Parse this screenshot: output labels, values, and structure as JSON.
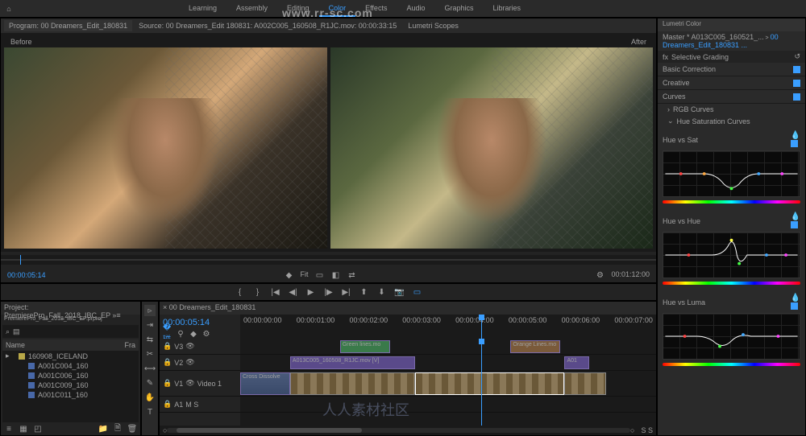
{
  "watermark": "www.rr-sc.com",
  "watermark2": "人人素材社区",
  "workspace_tabs": [
    "Learning",
    "Assembly",
    "Editing",
    "Color",
    "Effects",
    "Audio",
    "Graphics",
    "Libraries"
  ],
  "active_ws": "Color",
  "program": {
    "title": "Program: 00 Dreamers_Edit_180831",
    "source_tab": "Source: 00 Dreamers_Edit 180831: A002C005_160508_R1JC.mov: 00:00:33:15",
    "scopes_tab": "Lumetri Scopes",
    "before": "Before",
    "after": "After",
    "tc_in": "00:00:05:14",
    "tc_out": "00:01:12:00",
    "fit": "Fit"
  },
  "project": {
    "title": "Project: PremierePro_Fall_2018_IBC_EP",
    "bin": "PremierePro_Fall_2018_IBC_EP.prproj",
    "name_col": "Name",
    "fr_col": "Fra",
    "items": [
      {
        "icon": "bin",
        "label": "160908_ICELAND"
      },
      {
        "icon": "clip",
        "label": "A001C004_160"
      },
      {
        "icon": "clip",
        "label": "A001C006_160"
      },
      {
        "icon": "clip",
        "label": "A001C009_160"
      },
      {
        "icon": "clip",
        "label": "A001C011_160"
      }
    ]
  },
  "timeline": {
    "title": "00 Dreamers_Edit_180831",
    "tc": "00:00:05:14",
    "ruler": [
      "00:00:00:00",
      "00:00:01:00",
      "00:00:02:00",
      "00:00:03:00",
      "00:00:04:00",
      "00:00:05:00",
      "00:00:06:00",
      "00:00:07:00"
    ],
    "tracks": {
      "v3": "V3",
      "v2": "V2",
      "v1": "V1",
      "a1": "A1",
      "video1": "Video 1"
    },
    "clips": {
      "green": "Green lines.mo",
      "orange": "Orange Lines.mo",
      "main": "A013C005_160508_R1JC.mov [V]",
      "a01": "A01",
      "dissolve": "Cross Dissolve"
    }
  },
  "lumetri": {
    "title": "Lumetri Color",
    "master": "Master * A013C005_160521_...",
    "clip": "00 Dreamers_Edit_180831 ...",
    "fx": "fx",
    "effect": "Selective Grading",
    "sections": {
      "basic": "Basic Correction",
      "creative": "Creative",
      "curves": "Curves",
      "rgb": "RGB Curves",
      "hsc": "Hue Saturation Curves",
      "hvs": "Hue vs Sat",
      "hvh": "Hue vs Hue",
      "hvl": "Hue vs Luma"
    }
  }
}
